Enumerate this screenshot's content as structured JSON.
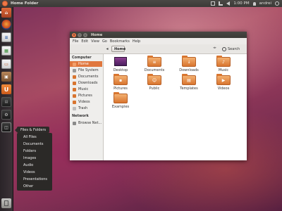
{
  "panel": {
    "title": "Home Folder",
    "time": "1:00 PM",
    "user": "andrei"
  },
  "window": {
    "title": "Home",
    "menus": [
      "File",
      "Edit",
      "View",
      "Go",
      "Bookmarks",
      "Help"
    ],
    "path_button": "Home",
    "search_label": "Search",
    "sidebar": {
      "computer_header": "Computer",
      "computer_items": [
        "Home",
        "File System",
        "Documents",
        "Downloads",
        "Music",
        "Pictures",
        "Videos",
        "Trash"
      ],
      "network_header": "Network",
      "network_items": [
        "Browse Net..."
      ]
    },
    "files": [
      "Desktop",
      "Documents",
      "Downloads",
      "Music",
      "Pictures",
      "Public",
      "Templates",
      "Videos",
      "Examples"
    ]
  },
  "dash": {
    "tooltip": "Files & Folders",
    "items": [
      "All Files",
      "Documents",
      "Folders",
      "Images",
      "Audio",
      "Videos",
      "Presentations",
      "Other"
    ]
  },
  "colors": {
    "accent": "#e0773e",
    "panel": "#3b3a37",
    "launcher": "#2f2a2d"
  }
}
